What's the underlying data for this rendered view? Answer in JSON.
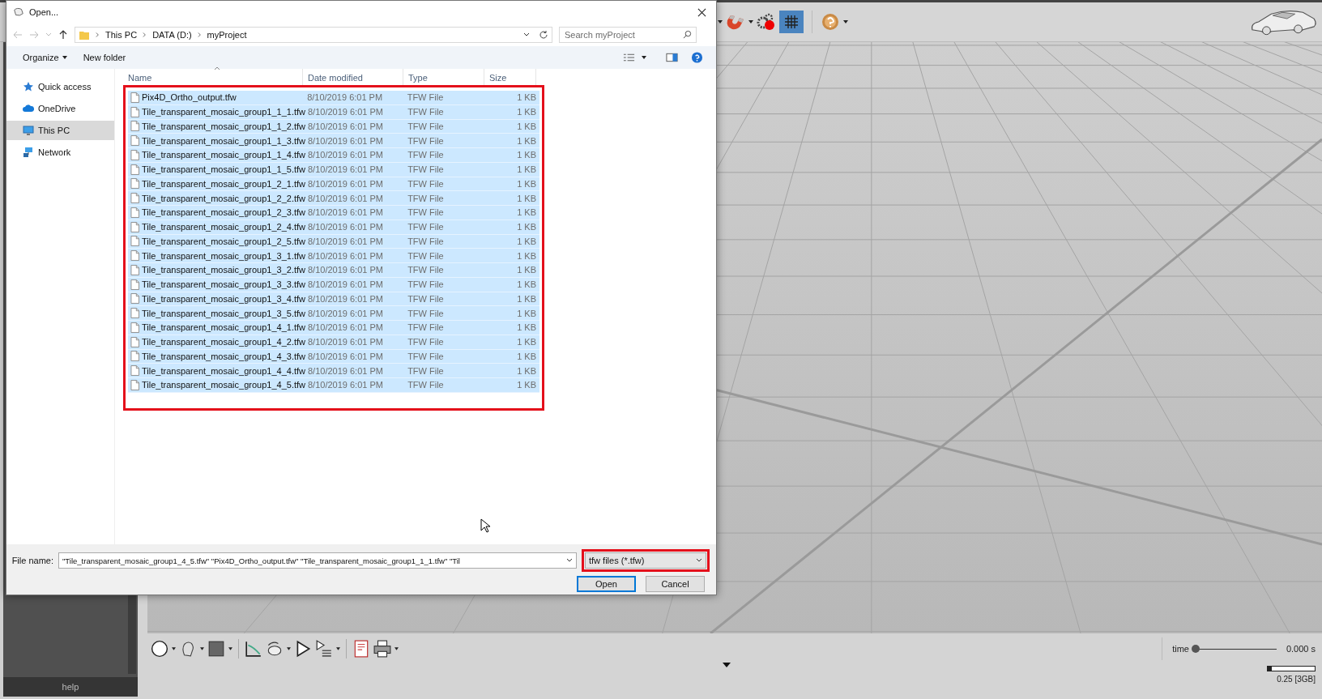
{
  "window": {
    "title": "Open..."
  },
  "breadcrumb": [
    "This PC",
    "DATA (D:)",
    "myProject"
  ],
  "search": {
    "placeholder": "Search myProject"
  },
  "commands": [
    "Organize",
    "New folder"
  ],
  "nav": [
    {
      "label": "Quick access",
      "selected": false
    },
    {
      "label": "OneDrive",
      "selected": false
    },
    {
      "label": "This PC",
      "selected": true
    },
    {
      "label": "Network",
      "selected": false
    }
  ],
  "columns": [
    "Name",
    "Date modified",
    "Type",
    "Size"
  ],
  "files": [
    {
      "name": "Pix4D_Ortho_output.tfw",
      "date": "8/10/2019 6:01 PM",
      "type": "TFW File",
      "size": "1 KB",
      "selected": true
    },
    {
      "name": "Tile_transparent_mosaic_group1_1_1.tfw",
      "date": "8/10/2019 6:01 PM",
      "type": "TFW File",
      "size": "1 KB",
      "selected": true
    },
    {
      "name": "Tile_transparent_mosaic_group1_1_2.tfw",
      "date": "8/10/2019 6:01 PM",
      "type": "TFW File",
      "size": "1 KB",
      "selected": true
    },
    {
      "name": "Tile_transparent_mosaic_group1_1_3.tfw",
      "date": "8/10/2019 6:01 PM",
      "type": "TFW File",
      "size": "1 KB",
      "selected": true
    },
    {
      "name": "Tile_transparent_mosaic_group1_1_4.tfw",
      "date": "8/10/2019 6:01 PM",
      "type": "TFW File",
      "size": "1 KB",
      "selected": true
    },
    {
      "name": "Tile_transparent_mosaic_group1_1_5.tfw",
      "date": "8/10/2019 6:01 PM",
      "type": "TFW File",
      "size": "1 KB",
      "selected": true
    },
    {
      "name": "Tile_transparent_mosaic_group1_2_1.tfw",
      "date": "8/10/2019 6:01 PM",
      "type": "TFW File",
      "size": "1 KB",
      "selected": true
    },
    {
      "name": "Tile_transparent_mosaic_group1_2_2.tfw",
      "date": "8/10/2019 6:01 PM",
      "type": "TFW File",
      "size": "1 KB",
      "selected": true
    },
    {
      "name": "Tile_transparent_mosaic_group1_2_3.tfw",
      "date": "8/10/2019 6:01 PM",
      "type": "TFW File",
      "size": "1 KB",
      "selected": true
    },
    {
      "name": "Tile_transparent_mosaic_group1_2_4.tfw",
      "date": "8/10/2019 6:01 PM",
      "type": "TFW File",
      "size": "1 KB",
      "selected": true
    },
    {
      "name": "Tile_transparent_mosaic_group1_2_5.tfw",
      "date": "8/10/2019 6:01 PM",
      "type": "TFW File",
      "size": "1 KB",
      "selected": true
    },
    {
      "name": "Tile_transparent_mosaic_group1_3_1.tfw",
      "date": "8/10/2019 6:01 PM",
      "type": "TFW File",
      "size": "1 KB",
      "selected": true
    },
    {
      "name": "Tile_transparent_mosaic_group1_3_2.tfw",
      "date": "8/10/2019 6:01 PM",
      "type": "TFW File",
      "size": "1 KB",
      "selected": true
    },
    {
      "name": "Tile_transparent_mosaic_group1_3_3.tfw",
      "date": "8/10/2019 6:01 PM",
      "type": "TFW File",
      "size": "1 KB",
      "selected": true
    },
    {
      "name": "Tile_transparent_mosaic_group1_3_4.tfw",
      "date": "8/10/2019 6:01 PM",
      "type": "TFW File",
      "size": "1 KB",
      "selected": true
    },
    {
      "name": "Tile_transparent_mosaic_group1_3_5.tfw",
      "date": "8/10/2019 6:01 PM",
      "type": "TFW File",
      "size": "1 KB",
      "selected": true
    },
    {
      "name": "Tile_transparent_mosaic_group1_4_1.tfw",
      "date": "8/10/2019 6:01 PM",
      "type": "TFW File",
      "size": "1 KB",
      "selected": true
    },
    {
      "name": "Tile_transparent_mosaic_group1_4_2.tfw",
      "date": "8/10/2019 6:01 PM",
      "type": "TFW File",
      "size": "1 KB",
      "selected": true
    },
    {
      "name": "Tile_transparent_mosaic_group1_4_3.tfw",
      "date": "8/10/2019 6:01 PM",
      "type": "TFW File",
      "size": "1 KB",
      "selected": true
    },
    {
      "name": "Tile_transparent_mosaic_group1_4_4.tfw",
      "date": "8/10/2019 6:01 PM",
      "type": "TFW File",
      "size": "1 KB",
      "selected": true
    },
    {
      "name": "Tile_transparent_mosaic_group1_4_5.tfw",
      "date": "8/10/2019 6:01 PM",
      "type": "TFW File",
      "size": "1 KB",
      "selected": true
    }
  ],
  "file_name": {
    "label": "File name:",
    "value": "\"Tile_transparent_mosaic_group1_4_5.tfw\" \"Pix4D_Ortho_output.tfw\" \"Tile_transparent_mosaic_group1_1_1.tfw\" \"Til"
  },
  "file_type": {
    "value": "tfw files (*.tfw)"
  },
  "buttons": [
    "Open",
    "Cancel"
  ],
  "grid_toggle": {
    "on": true
  },
  "help": "help",
  "time": {
    "label": "time",
    "level": 0,
    "reading": "0.000 s"
  },
  "memory": {
    "level": 0.08,
    "reading": "0.25 [3GB]"
  }
}
